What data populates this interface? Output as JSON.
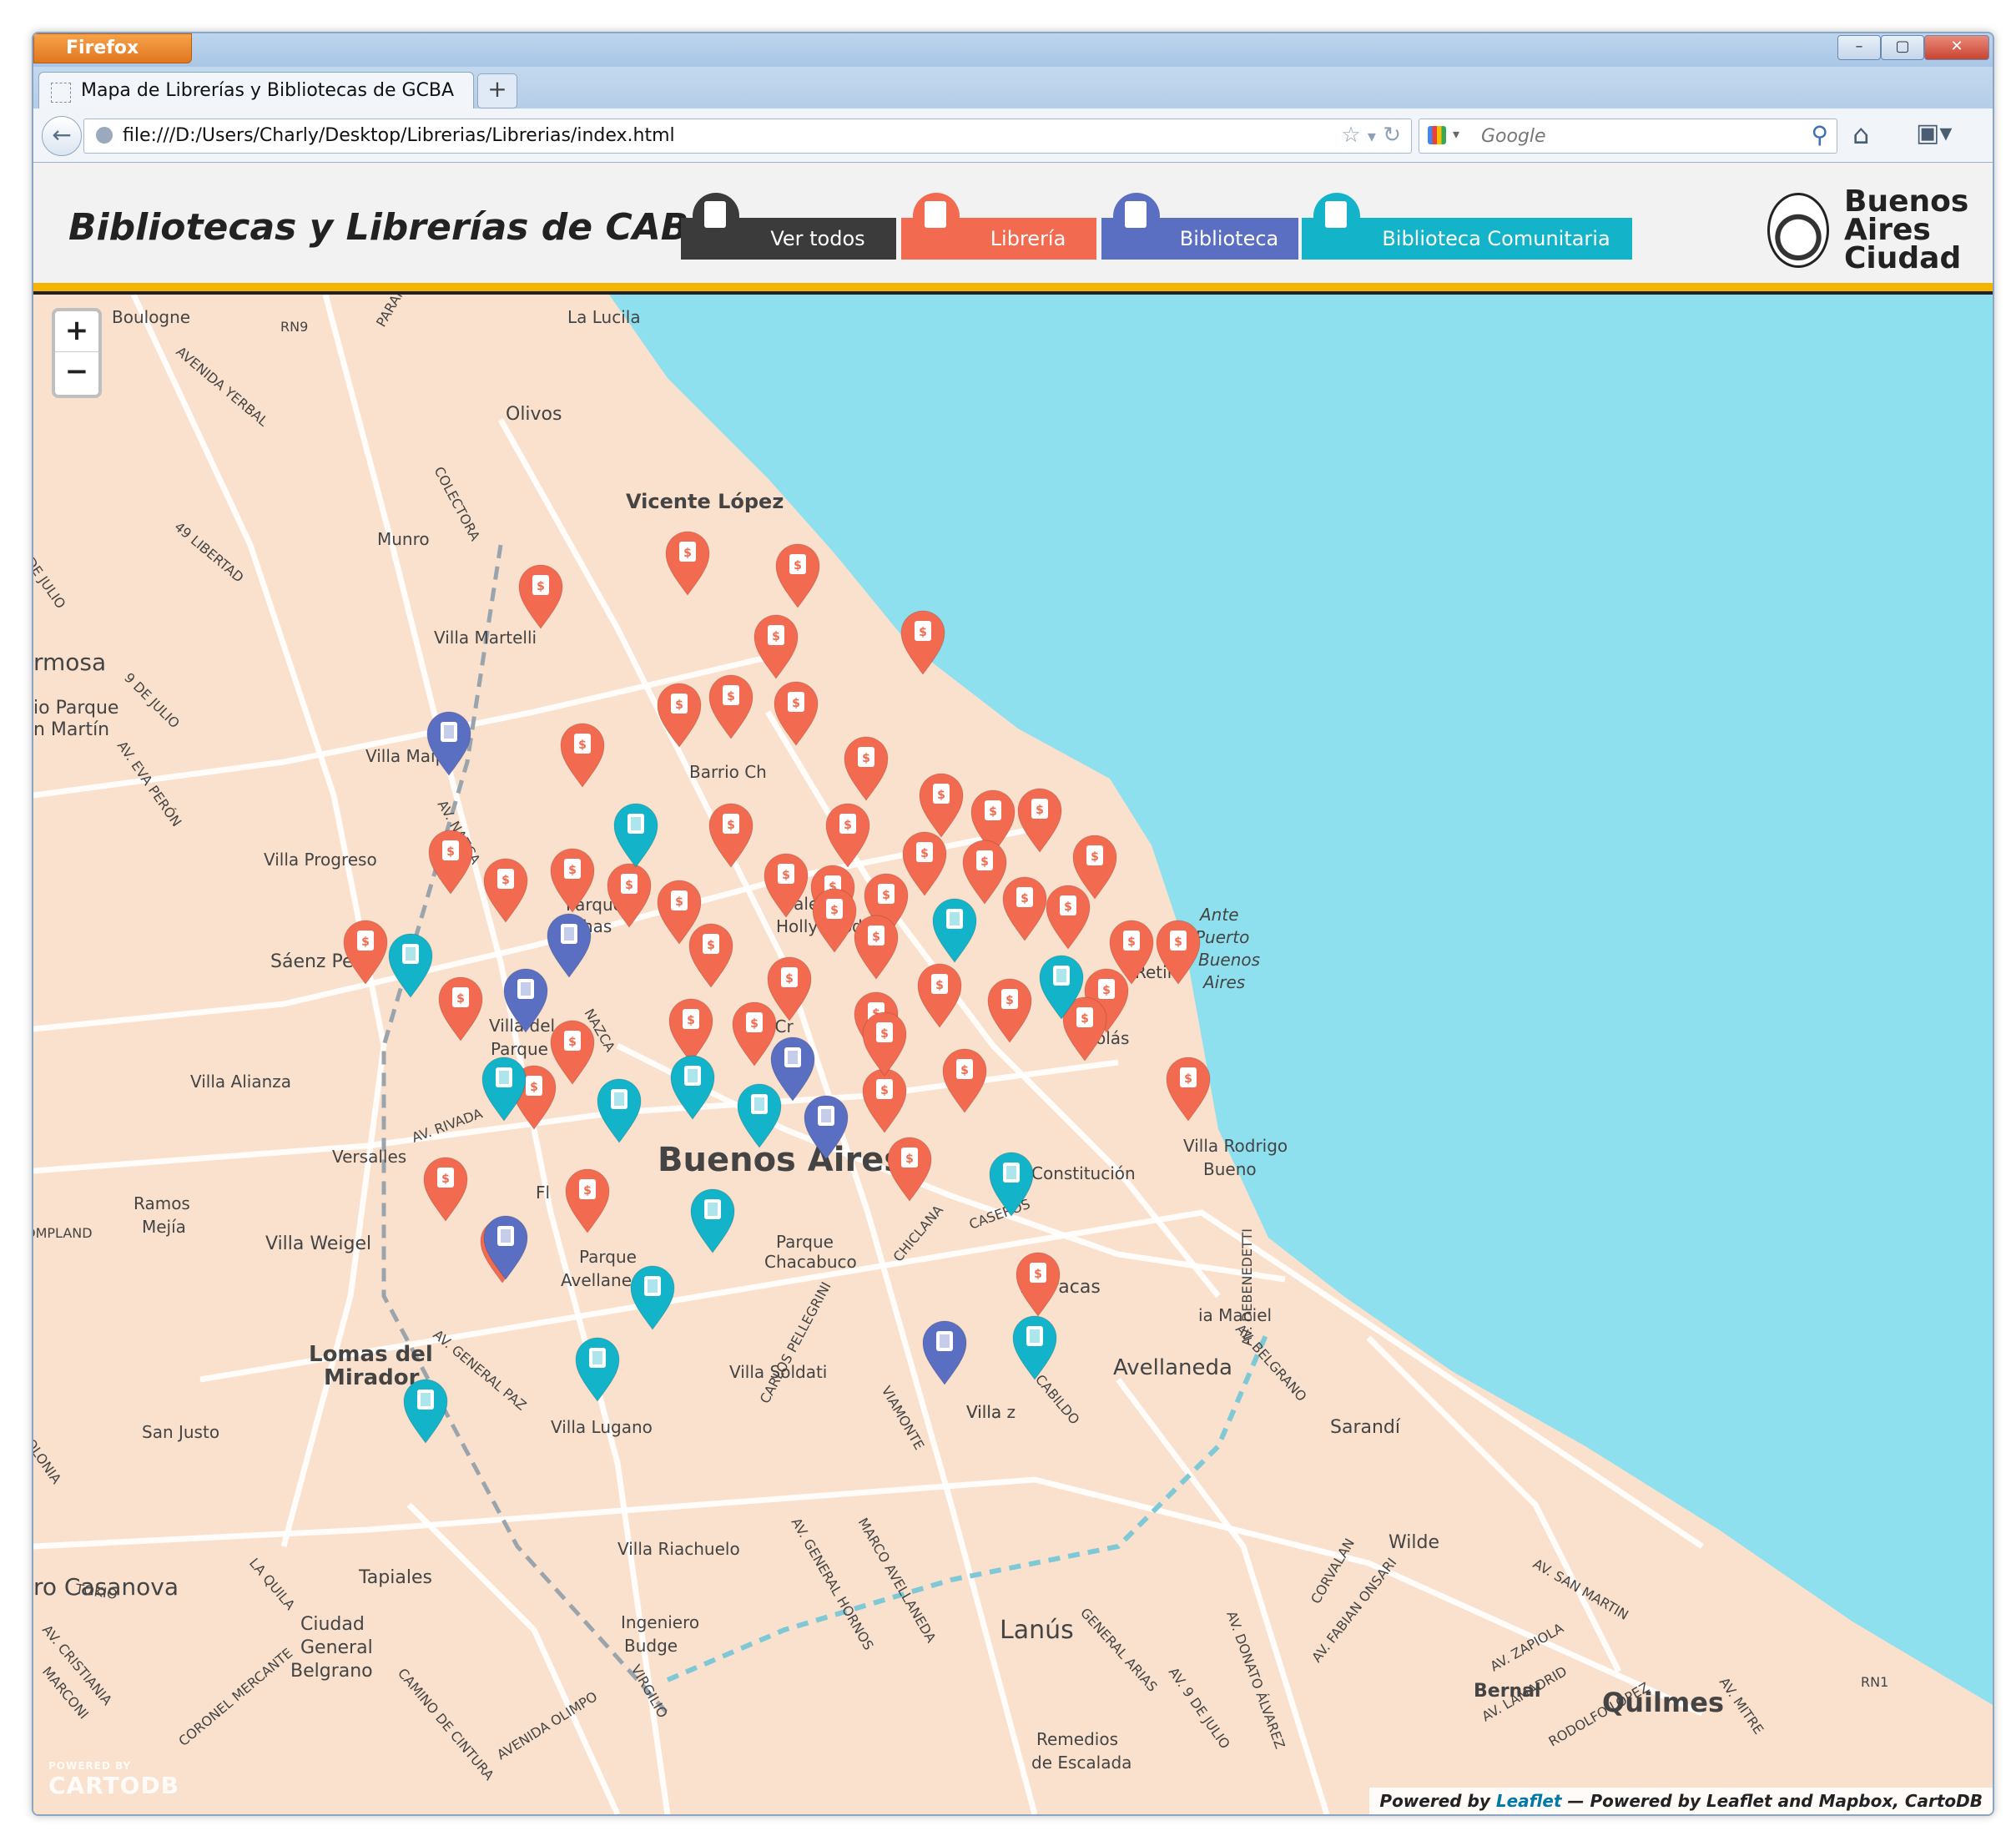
{
  "browser": {
    "app_button": "Firefox",
    "tab_title": "Mapa de Librerías y Bibliotecas de GCBA",
    "new_tab": "+",
    "url": "file:///D:/Users/Charly/Desktop/Librerias/Librerias/index.html",
    "search_placeholder": "Google",
    "window_buttons": {
      "minimize": "–",
      "maximize": "▢",
      "close": "✕"
    }
  },
  "header": {
    "title": "Bibliotecas y Librerías de CABA",
    "buttons": [
      {
        "label": "Ver todos",
        "color": "#3b3b3b"
      },
      {
        "label": "Librería",
        "color": "#f26b50"
      },
      {
        "label": "Biblioteca",
        "color": "#5a6fc2"
      },
      {
        "label": "Biblioteca Comunitaria",
        "color": "#13b4c9"
      }
    ],
    "logo_text": "Buenos\nAires\nCiudad"
  },
  "map": {
    "zoom_in": "+",
    "zoom_out": "−",
    "water_color": "#8fe0ef",
    "land_color": "#f9e1cd",
    "place_labels": [
      "Boulogne",
      "La Lucila",
      "Olivos",
      "Vicente López",
      "Munro",
      "Villa Martelli",
      "rmosa",
      "io Parque",
      "n Martín",
      "Villa Maipú",
      "Villa Progreso",
      "Sáenz Peña",
      "Villa Alianza",
      "Versalles",
      "Ramos",
      "Mejía",
      "Villa Weigel",
      "Lomas del",
      "Mirador",
      "San Justo",
      "ro Casanova",
      "Tapiales",
      "Ciudad",
      "General",
      "Belgrano",
      "Ingeniero",
      "Budge",
      "Villa Riachuelo",
      "Villa Lugano",
      "Villa Soldati",
      "Parque",
      "Avellaneda",
      "Parque",
      "Chacabuco",
      "Barracas",
      "Avellaneda",
      "Sarandí",
      "Wilde",
      "Lanús",
      "Bernal",
      "Quilmes",
      "Remedios",
      "de Escalada",
      "Buenos Aires",
      "Palermo",
      "Hollywood",
      "Barrio Ch",
      "Parque",
      "Chas",
      "Villa del",
      "Parque",
      "Fl",
      "Constitución",
      "Villa Rodrigo",
      "Bueno",
      "Ante",
      "Puerto",
      "Buenos",
      "Aires",
      "Retiro",
      "colás",
      "Villa Cr",
      "ia Maciel",
      "Villa z",
      "Villa"
    ],
    "road_labels": [
      "RN9",
      "AVENIDA YERBAL",
      "PARANA",
      "COLECTORA",
      "49 LIBERTAD",
      "DE JULIO",
      "9 DE JULIO",
      "AV. EVA PERÓN",
      "AV. NAZCA",
      "AV. RIVADA",
      "AV. GENERAL PAZ",
      "CARLOS PELLEGRINI",
      "VIAMONTE",
      "CABILDO",
      "AV. BELGRANO",
      "AV. DEBENEDETTI",
      "AV. GENERAL HORNOS",
      "MARCO AVELLANEDA",
      "GENERAL ARIAS",
      "AV. 9 DE JULIO",
      "AV. DONATO ÁLVAREZ",
      "CORVALAN",
      "AV. FABIAN ONSARI",
      "AV. SAN MARTIN",
      "AV. ZAPIOLA",
      "AV. LAMADRID",
      "RODOLFO LÓPEZ",
      "AV. MITRE",
      "RN1",
      "LA QUILA",
      "TOKIO",
      "AV. CRISTIANIA",
      "MARCONI",
      "CORONEL MERCANTE",
      "CAMINO DE CINTURA",
      "VIRGILIO",
      "AVENIDA OLIMPO",
      "CHICLANA",
      "CASEROS",
      "OMPLAND",
      "OLONIA",
      "NAZCA"
    ],
    "markers": {
      "libreria": 54,
      "biblioteca": 7,
      "biblioteca_comunitaria": 14
    },
    "marker_icons": {
      "libreria": "dollar-book-icon",
      "biblioteca": "books-icon",
      "biblioteca_comunitaria": "books-icon"
    },
    "attribution": {
      "prefix": "Powered by ",
      "link": "Leaflet",
      "suffix": " — Powered by Leaflet and Mapbox, CartoDB"
    },
    "cartodb_small": "POWERED BY",
    "cartodb": "CARTODB"
  }
}
